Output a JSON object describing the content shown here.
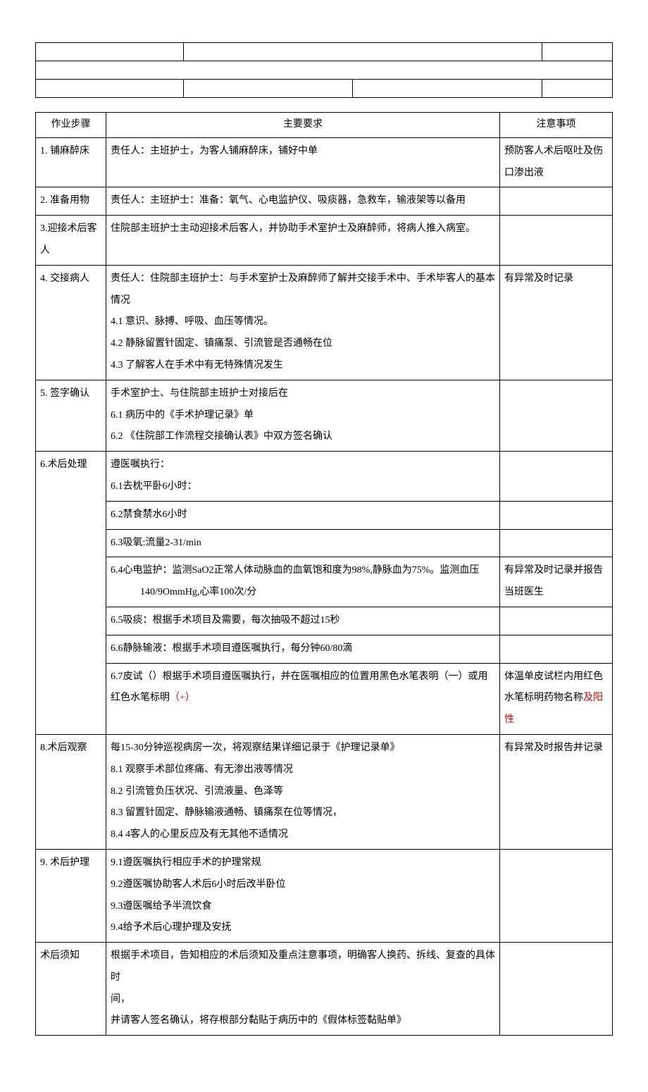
{
  "headers": {
    "step": "作业步骤",
    "req": "主要要求",
    "note": "注意事项"
  },
  "rows": [
    {
      "step": "1. 铺麻醉床",
      "req": "责任人：主班护士，为客人铺麻醉床，铺好中单",
      "note": "预防客人术后呕吐及伤口渗出液"
    },
    {
      "step": "2. 准备用物",
      "req": "责任人：主班护士：准备：氧气、心电监护仪、吸痰器，急救车，输液架等以备用",
      "note": ""
    },
    {
      "step": "3.迎接术后客人",
      "req": "住院部主班护士主动迎接术后客人，并协助手术室护士及麻醉师，将病人推入病室。",
      "note": ""
    },
    {
      "step": "4. 交接病人",
      "req_lines": [
        "责任人：住院部主班护士：与手术室护士及麻醉师了解并交接手术中、手术毕客人的基本情况",
        "4.1   意识、脉搏、呼吸、血压等情况。",
        "4.2   静脉留置针固定、镇痛泵、引流管是否通畅在位",
        "4.3   了解客人在手术中有无特殊情况发生"
      ],
      "note": "有异常及时记录"
    },
    {
      "step": "5. 签字确认",
      "req_lines": [
        "手术室护士、与住院部主班护士对接后在",
        "6.1   病历中的《手术护理记录》单",
        "6.2   《住院部工作流程交接确认表》中双方签名确认"
      ],
      "note": ""
    },
    {
      "step": "6.术后处理",
      "subrows": [
        {
          "req_lines": [
            "遵医嘱执行：",
            "6.1去枕平卧6小时："
          ],
          "note": ""
        },
        {
          "req": "6.2禁食禁水6小时",
          "note": ""
        },
        {
          "req": "6.3吸氧:流量2-31/min",
          "note": ""
        },
        {
          "req_lines": [
            "6.4心电监护：监测SaO2正常人体动脉血的血氧饱和度为98%,静脉血为75%。监测血压",
            "        140/9OmmHg,心率100次/分"
          ],
          "note": "有异常及时记录并报告当班医生"
        },
        {
          "req": "6.5吸痰：根据手术项目及需要，每次抽吸不超过15秒",
          "note": ""
        },
        {
          "req": "6.6静脉输液：根据手术项目遵医嘱执行，每分钟60/80滴",
          "note": ""
        },
        {
          "req_lines_mixed": [
            {
              "t": "6.7皮试（）根据手术项目遵医嘱执行，并在医嘱相应的位置用黑色水笔表明（一）或用红色水笔标明"
            },
            {
              "t": "（+）",
              "red": true
            }
          ],
          "note_mixed": [
            {
              "t": "体温单皮试栏内用红色水笔标明药物名称"
            },
            {
              "t": "及阳性",
              "red": true
            }
          ]
        }
      ]
    },
    {
      "step": "8.术后观察",
      "req_lines": [
        "每15-30分钟巡视病房一次，将观察结果详细记录于《护理记录单》",
        "8.1   观察手术部位疼痛、有无渗出液等情况",
        "8.2   引流管负压状况、引流液量、色泽等",
        "8.3   留置针固定、静脉输液通畅、镇痛泵在位等情况，",
        "8.4  4客人的心里反应及有无其他不适情况"
      ],
      "note": "有异常及时报告并记录"
    },
    {
      "step": "9. 术后护理",
      "req_lines": [
        "9.1遵医嘱执行相应手术的护理常规",
        "9.2遵医嘱协助客人术后6小时后改半卧位",
        "9.3遵医嘱给予半流饮食",
        "9.4给予术后心理护理及安抚"
      ],
      "note": ""
    },
    {
      "step": "术后须知",
      "req_lines": [
        "根据手术项目，告知相应的术后须知及重点注意事项，明确客人换药、拆线、复查的具体时",
        "    间，",
        "并请客人签名确认，将存根部分黏贴于病历中的《假体标签黏贴单》"
      ],
      "note": ""
    }
  ]
}
